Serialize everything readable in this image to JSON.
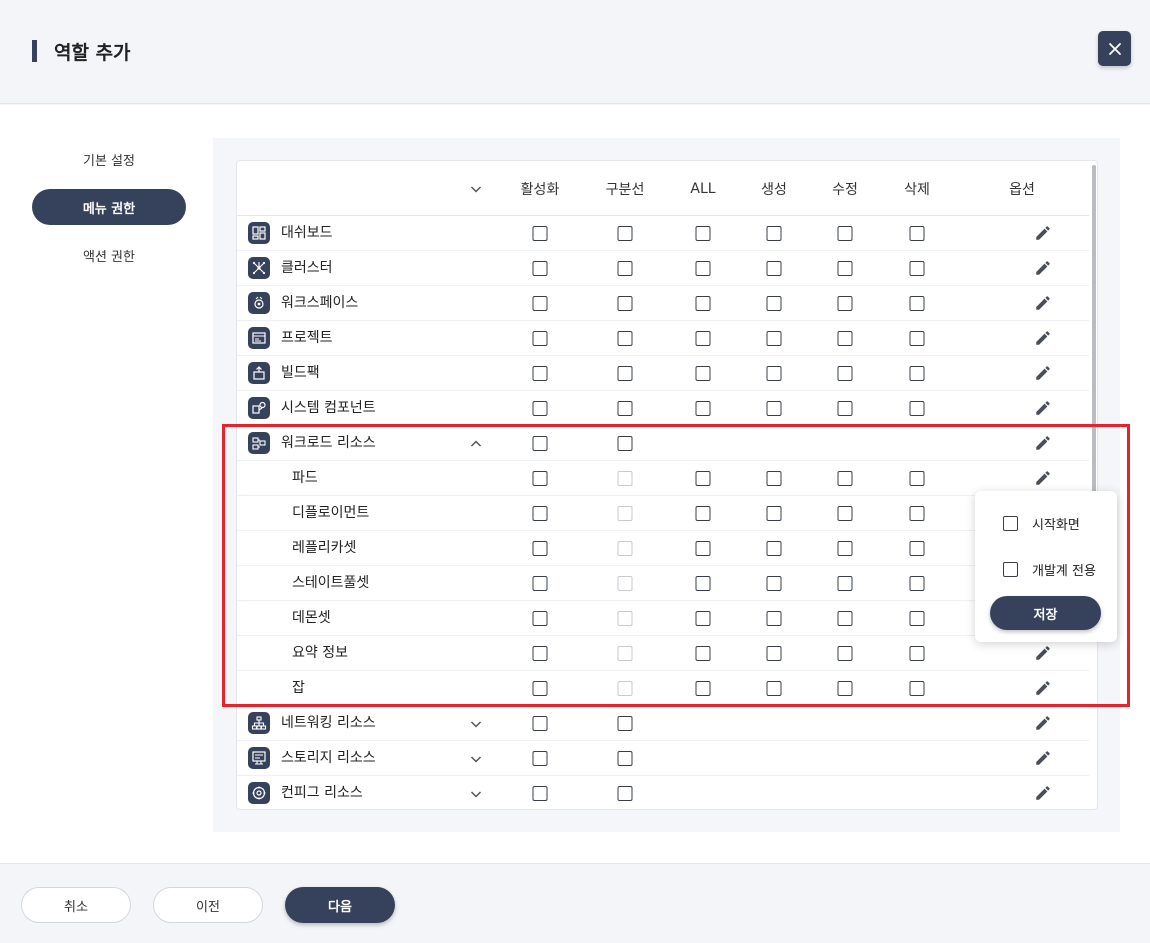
{
  "header": {
    "title": "역할 추가"
  },
  "nav": [
    {
      "label": "기본 설정",
      "active": false
    },
    {
      "label": "메뉴 권한",
      "active": true
    },
    {
      "label": "액션 권한",
      "active": false
    }
  ],
  "columns": [
    "활성화",
    "구분선",
    "ALL",
    "생성",
    "수정",
    "삭제",
    "옵션"
  ],
  "rows": [
    {
      "label": "대쉬보드",
      "icon": "dashboard-icon",
      "type": "top"
    },
    {
      "label": "클러스터",
      "icon": "cluster-icon",
      "type": "top"
    },
    {
      "label": "워크스페이스",
      "icon": "workspace-icon",
      "type": "top"
    },
    {
      "label": "프로젝트",
      "icon": "project-icon",
      "type": "top"
    },
    {
      "label": "빌드팩",
      "icon": "buildpack-icon",
      "type": "top"
    },
    {
      "label": "시스템 컴포넌트",
      "icon": "system-component-icon",
      "type": "top"
    },
    {
      "label": "워크로드 리소스",
      "icon": "workload-icon",
      "type": "group",
      "expanded": true
    },
    {
      "label": "파드",
      "type": "sub"
    },
    {
      "label": "디플로이먼트",
      "type": "sub"
    },
    {
      "label": "레플리카셋",
      "type": "sub"
    },
    {
      "label": "스테이트풀셋",
      "type": "sub"
    },
    {
      "label": "데몬셋",
      "type": "sub"
    },
    {
      "label": "요약 정보",
      "type": "sub"
    },
    {
      "label": "잡",
      "type": "sub"
    },
    {
      "label": "네트워킹 리소스",
      "icon": "network-icon",
      "type": "group",
      "expanded": false
    },
    {
      "label": "스토리지 리소스",
      "icon": "storage-icon",
      "type": "group",
      "expanded": false
    },
    {
      "label": "컨피그 리소스",
      "icon": "config-icon",
      "type": "group",
      "expanded": false
    }
  ],
  "popup": {
    "options": [
      "시작화면",
      "개발계 전용"
    ],
    "save_label": "저장"
  },
  "footer": {
    "cancel": "취소",
    "prev": "이전",
    "next": "다음"
  },
  "colors": {
    "primary": "#36425c",
    "highlight": "#e5232d"
  }
}
